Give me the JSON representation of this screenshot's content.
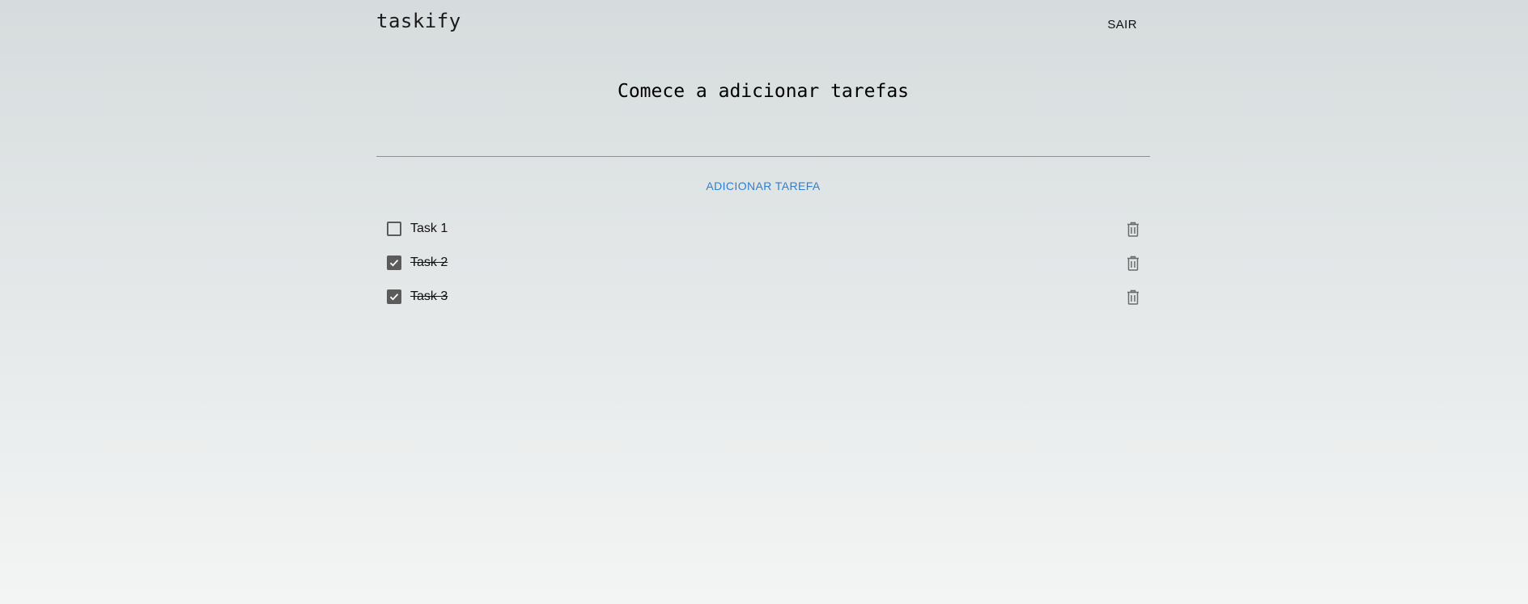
{
  "header": {
    "logo": "taskify",
    "logout_label": "SAIR"
  },
  "main": {
    "heading": "Comece a adicionar tarefas",
    "input": {
      "value": "",
      "placeholder": ""
    },
    "add_button_label": "ADICIONAR TAREFA"
  },
  "tasks": [
    {
      "label": "Task 1",
      "done": false
    },
    {
      "label": "Task 2",
      "done": true
    },
    {
      "label": "Task 3",
      "done": true
    }
  ],
  "icons": {
    "checkbox_checked": "check-icon",
    "delete": "trash-icon"
  },
  "colors": {
    "accent": "#2f7fd0",
    "checkbox": "#5b5b5b",
    "icon": "#6b6b6b"
  }
}
